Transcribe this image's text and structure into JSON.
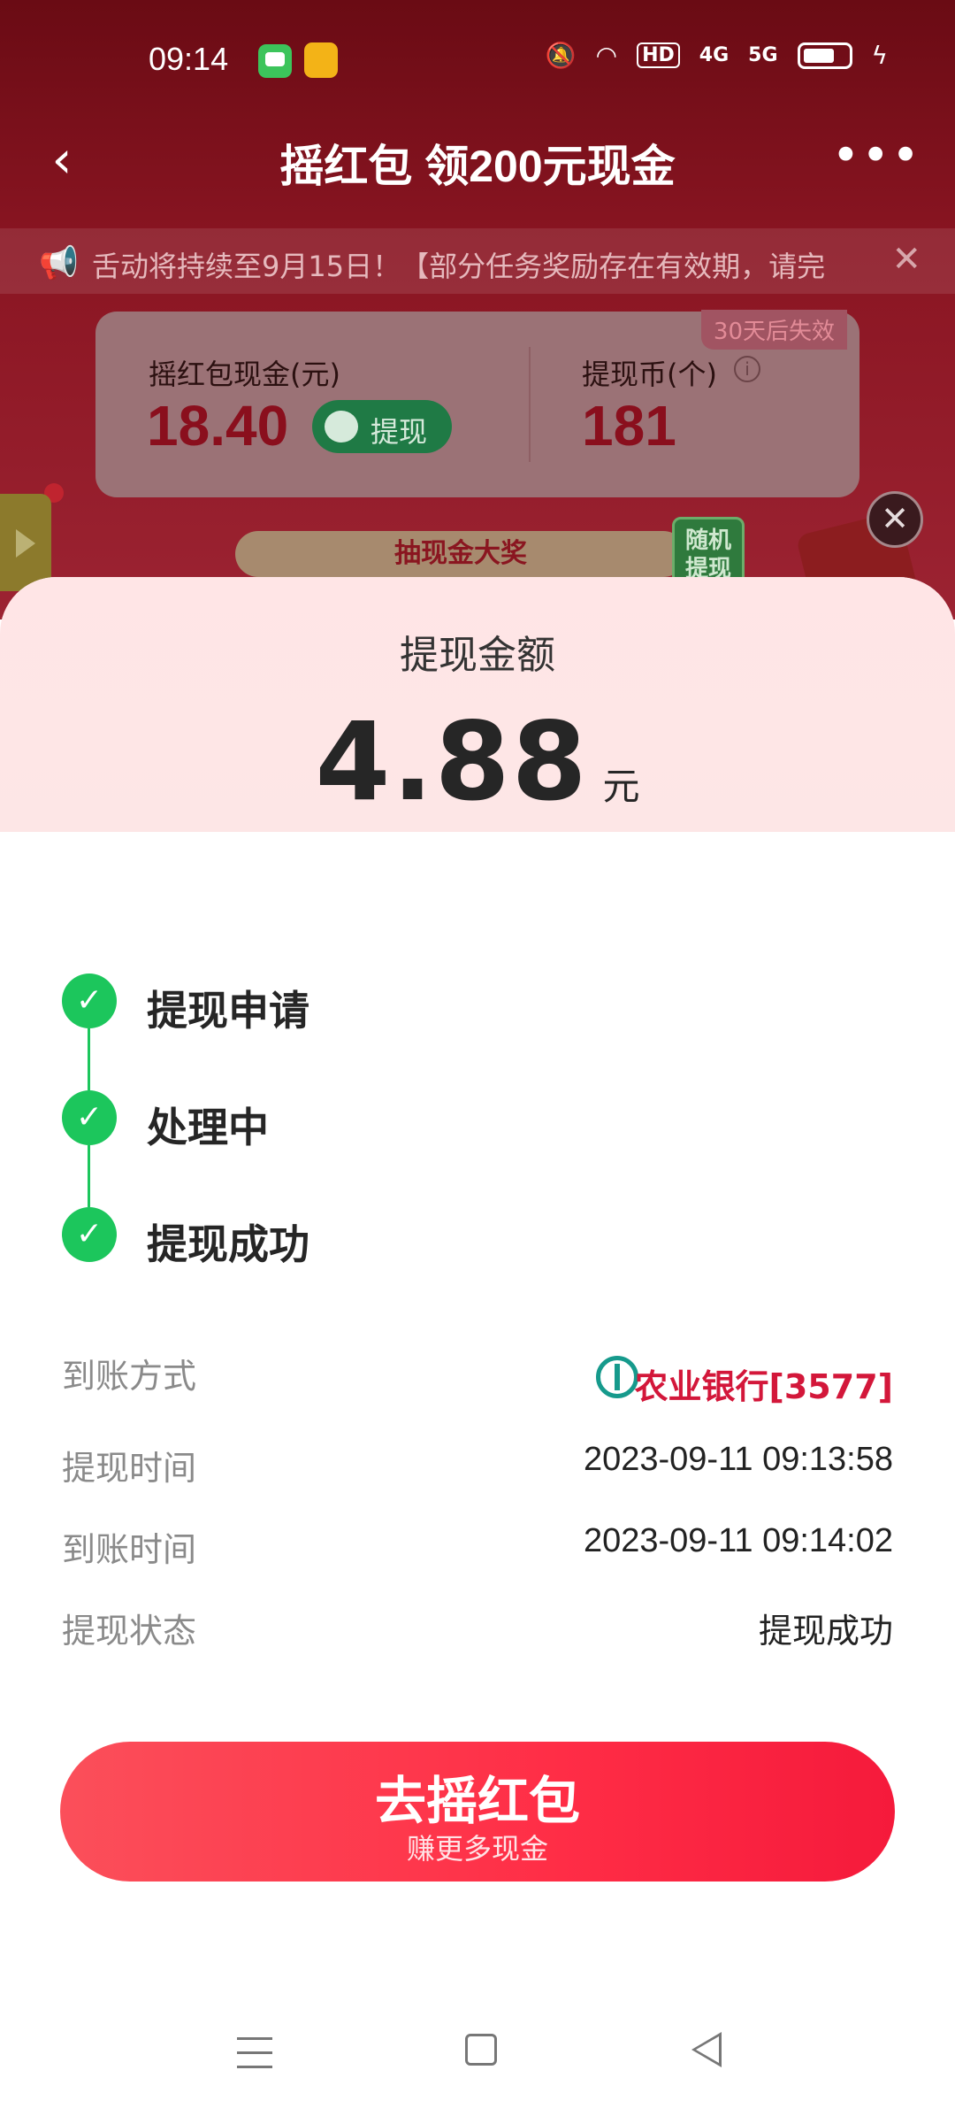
{
  "status_bar": {
    "time": "09:14",
    "icons": [
      "messages-app-icon",
      "game-app-icon",
      "mute-icon",
      "wifi-icon",
      "hd-icon",
      "signal-4g-icon",
      "signal-5g-icon",
      "battery-icon",
      "charging-icon"
    ],
    "hd_label": "HD",
    "net1": "4G",
    "net2": "5G"
  },
  "nav": {
    "title": "摇红包 领200元现金",
    "back_icon": "‹",
    "more_icon": "•••"
  },
  "notice": {
    "text": "舌动将持续至9月15日！【部分任务奖励存在有效期，请完",
    "close_icon": "✕"
  },
  "balance_card": {
    "expire_tag": "30天后失效",
    "cash_label": "摇红包现金(元)",
    "cash_value": "18.40",
    "withdraw_label": "提现",
    "coin_label": "提现币(个)",
    "coin_info": "i",
    "coin_value": "181"
  },
  "lottery": {
    "label": "抽现金大奖",
    "random_tag_line1": "随机",
    "random_tag_line2": "提现"
  },
  "sheet": {
    "amount_label": "提现金额",
    "amount_value": "4.88",
    "amount_unit": "元",
    "steps": [
      {
        "label": "提现申请",
        "done": true
      },
      {
        "label": "处理中",
        "done": true
      },
      {
        "label": "提现成功",
        "done": true
      }
    ],
    "info": {
      "method_key": "到账方式",
      "method_value": "农业银行[3577]",
      "apply_time_key": "提现时间",
      "apply_time_value": "2023-09-11 09:13:58",
      "arrive_time_key": "到账时间",
      "arrive_time_value": "2023-09-11 09:14:02",
      "status_key": "提现状态",
      "status_value": "提现成功"
    },
    "cta": {
      "title": "去摇红包",
      "subtitle": "赚更多现金"
    }
  },
  "colors": {
    "accent_red": "#ff2d46",
    "success_green": "#1cc65c",
    "bank_red": "#d3173a",
    "bank_teal": "#169a8c"
  }
}
